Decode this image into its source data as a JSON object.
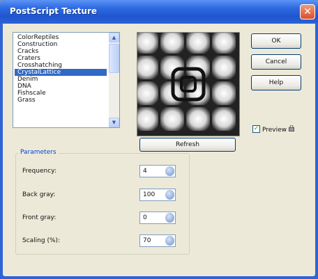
{
  "window": {
    "title": "PostScript Texture",
    "close_glyph": "✕"
  },
  "texture_list": {
    "items": [
      "ColorReptiles",
      "Construction",
      "Cracks",
      "Craters",
      "Crosshatching",
      "CrystalLattice",
      "Denim",
      "DNA",
      "Fishscale",
      "Grass"
    ],
    "selected_index": 5
  },
  "buttons": {
    "ok": "OK",
    "cancel": "Cancel",
    "help": "Help",
    "refresh": "Refresh"
  },
  "preview_check": {
    "label": "Preview ",
    "checked": true,
    "check_glyph": "✓",
    "icon": "preview-lock-icon"
  },
  "parameters": {
    "title": "Parameters",
    "rows": [
      {
        "label": "Frequency:",
        "value": "4"
      },
      {
        "label": "Back gray:",
        "value": "100"
      },
      {
        "label": "Front gray:",
        "value": "0"
      },
      {
        "label": "Scaling (%):",
        "value": "70"
      }
    ]
  },
  "colors": {
    "title_bar": "#2d69e0",
    "selection": "#316ac5",
    "group_title": "#0046d5",
    "dialog_bg": "#ece9d8"
  }
}
